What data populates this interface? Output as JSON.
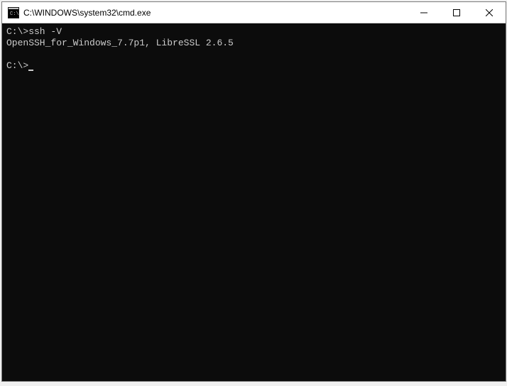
{
  "window": {
    "title": "C:\\WINDOWS\\system32\\cmd.exe"
  },
  "terminal": {
    "lines": [
      "C:\\>ssh -V",
      "OpenSSH_for_Windows_7.7p1, LibreSSL 2.6.5",
      "",
      "C:\\>"
    ]
  }
}
